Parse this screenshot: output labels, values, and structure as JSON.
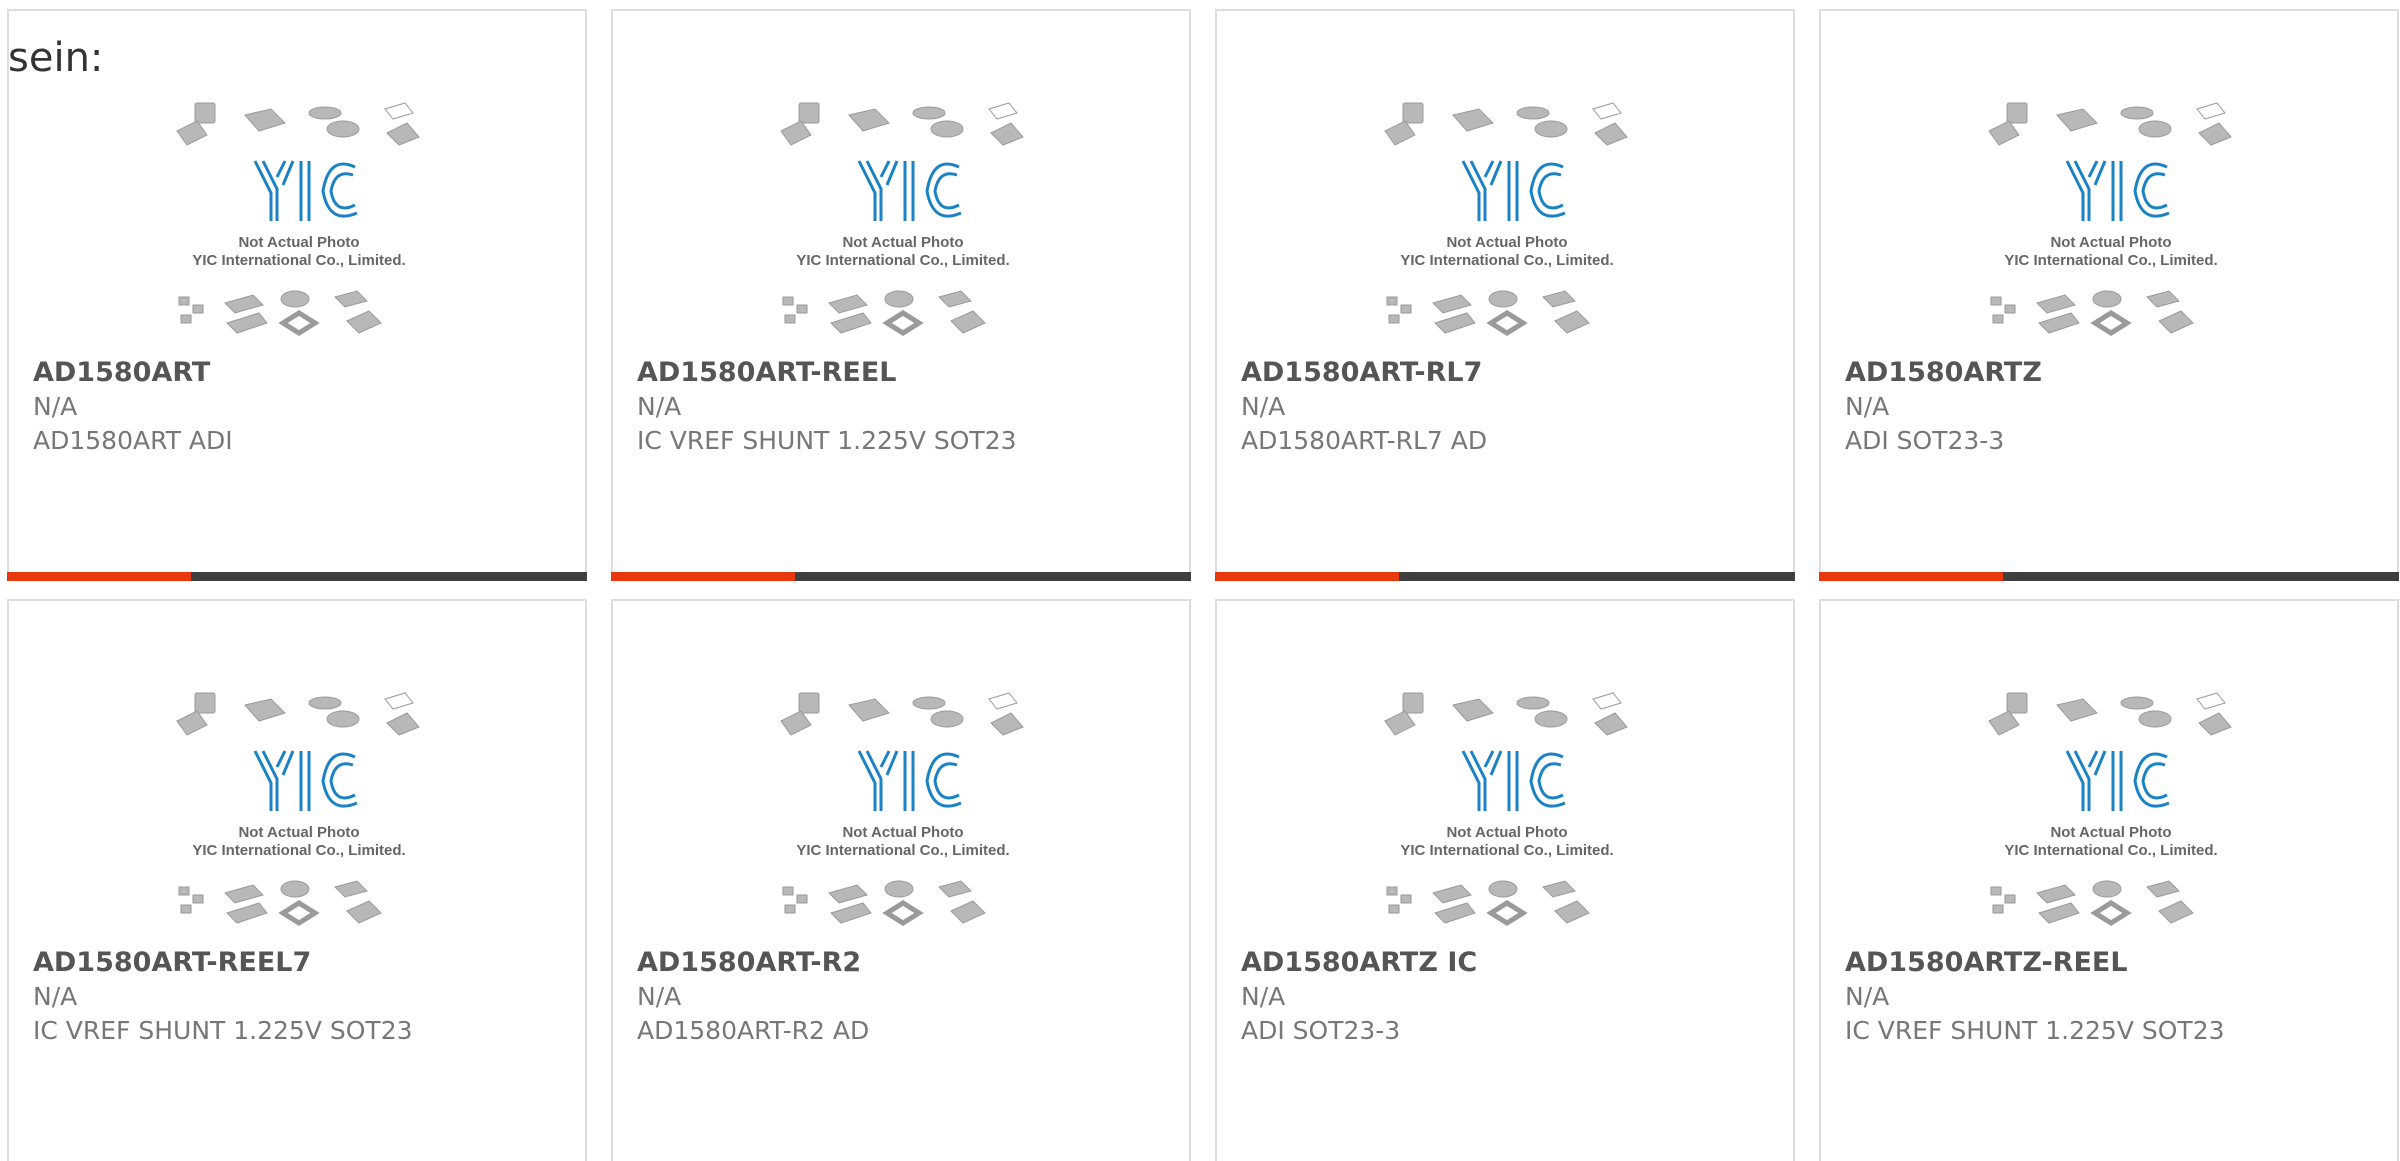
{
  "intro_text": "sein:",
  "colors": {
    "accent": "#e8380d",
    "bar": "#3f3f3f",
    "logo": "#1b82c4",
    "chip": "#b5b5b5"
  },
  "placeholder": {
    "line1": "Not Actual Photo",
    "line2": "YIC International Co., Limited.",
    "logo_text": "YIC"
  },
  "products": [
    {
      "part": "AD1580ART",
      "manufacturer": "N/A",
      "description": "AD1580ART ADI"
    },
    {
      "part": "AD1580ART-REEL",
      "manufacturer": "N/A",
      "description": "IC VREF SHUNT 1.225V SOT23"
    },
    {
      "part": "AD1580ART-RL7",
      "manufacturer": "N/A",
      "description": "AD1580ART-RL7 AD"
    },
    {
      "part": "AD1580ARTZ",
      "manufacturer": "N/A",
      "description": "ADI SOT23-3"
    },
    {
      "part": "AD1580ART-REEL7",
      "manufacturer": "N/A",
      "description": "IC VREF SHUNT 1.225V SOT23"
    },
    {
      "part": "AD1580ART-R2",
      "manufacturer": "N/A",
      "description": "AD1580ART-R2 AD"
    },
    {
      "part": "AD1580ARTZ IC",
      "manufacturer": "N/A",
      "description": "ADI SOT23-3"
    },
    {
      "part": "AD1580ARTZ-REEL",
      "manufacturer": "N/A",
      "description": "IC VREF SHUNT 1.225V SOT23"
    }
  ]
}
